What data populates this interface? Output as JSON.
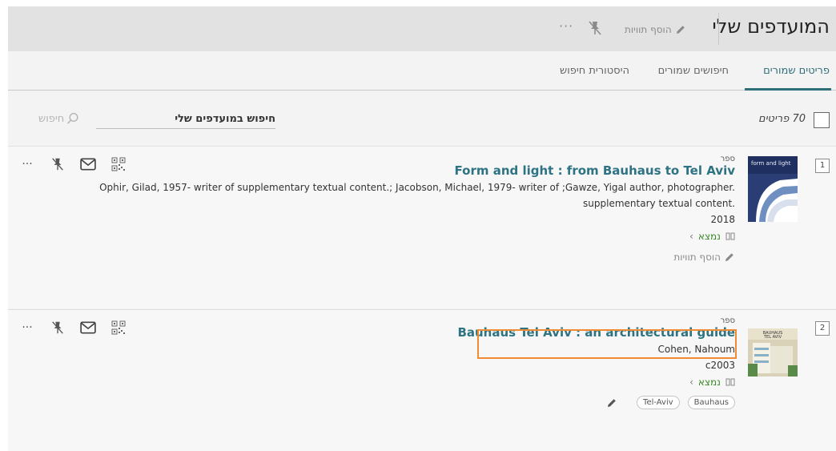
{
  "header": {
    "title": "המועדפים שלי",
    "add_tags": "הוסף תוויות",
    "more": "···"
  },
  "tabs": [
    {
      "label": "פריטים שמורים",
      "active": true
    },
    {
      "label": "חיפושים שמורים",
      "active": false
    },
    {
      "label": "היסטורית חיפוש",
      "active": false
    }
  ],
  "toolbar": {
    "count_label": "70 פריטים",
    "favorites_search_label": "חיפוש במועדפים שלי",
    "search_button": "חיפוש"
  },
  "items": [
    {
      "number": "1",
      "type": "ספר",
      "title": "Form and light : from Bauhaus to Tel Aviv",
      "authors_line1": "Ophir, Gilad, 1957- writer of supplementary textual content.; Jacobson, Michael, 1979- writer of ;Gawze, Yigal author, photographer.",
      "authors_line2": "supplementary textual content.",
      "year": "2018",
      "availability": "נמצא",
      "add_tags": "הוסף תוויות",
      "tags": [],
      "thumb_colors": [
        "#2a3d75",
        "#ffffff",
        "#6f8fc0"
      ]
    },
    {
      "number": "2",
      "type": "ספר",
      "title": "Bauhaus Tel Aviv : an architectural guide",
      "authors_line1": "Cohen, Nahoum",
      "authors_line2": "",
      "year": "c2003",
      "availability": "נמצא",
      "add_tags": "",
      "tags": [
        "Tel-Aviv",
        "Bauhaus"
      ],
      "thumb_colors": [
        "#d9d2b8",
        "#5a8a4a",
        "#8ab0c8"
      ]
    }
  ],
  "colors": {
    "accent": "#2f6f7a",
    "title_link": "#2e7383",
    "available": "#3a8a28",
    "highlight": "#f08a33"
  }
}
